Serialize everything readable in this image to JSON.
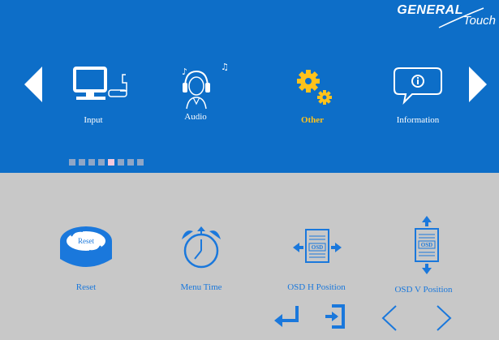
{
  "brand": {
    "name": "GENERAL",
    "suffix": "Touch"
  },
  "menu": {
    "items": [
      {
        "label": "Input",
        "icon": "computer-input-icon"
      },
      {
        "label": "Audio",
        "icon": "headphones-user-icon"
      },
      {
        "label": "Other",
        "icon": "gears-icon",
        "selected": true
      },
      {
        "label": "Information",
        "icon": "info-bubble-icon"
      }
    ],
    "page_indicator": {
      "count": 8,
      "active_index": 4
    }
  },
  "submenu": {
    "items": [
      {
        "label": "Reset",
        "icon": "reset-icon",
        "icon_text": "Reset"
      },
      {
        "label": "Menu Time",
        "icon": "alarm-clock-icon"
      },
      {
        "label": "OSD H Position",
        "icon": "osd-h-position-icon",
        "icon_text": "OSD"
      },
      {
        "label": "OSD V Position",
        "icon": "osd-v-position-icon",
        "icon_text": "OSD"
      }
    ]
  },
  "controls": [
    "enter-icon",
    "exit-icon",
    "left-icon",
    "right-icon"
  ],
  "colors": {
    "top_bg": "#0d6ec8",
    "bottom_bg": "#c8c8c8",
    "selected": "#ffc21a",
    "accent": "#1a78dc"
  }
}
